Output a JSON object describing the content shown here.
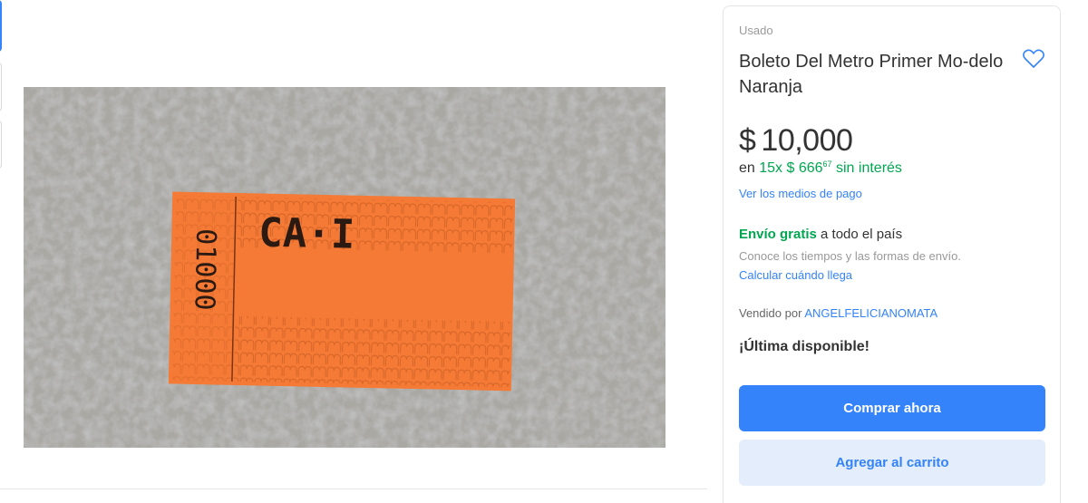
{
  "product": {
    "condition": "Usado",
    "title": "Boleto Del Metro Primer Mo-delo Naranja",
    "price": {
      "currency": "$",
      "amount": "10,000"
    },
    "installments": {
      "prefix": "en",
      "plan": "15x $ 666",
      "cents": "67",
      "suffix": "sin interés"
    },
    "payment_link": "Ver los medios de pago",
    "shipping": {
      "free": "Envío gratis",
      "rest": "a todo el país",
      "note": "Conoce los tiempos y las formas de envío.",
      "link": "Calcular cuándo llega"
    },
    "seller": {
      "label": "Vendido por",
      "name": "ANGELFELICIANOMATA"
    },
    "stock": "¡Última disponible!",
    "buy_label": "Comprar ahora",
    "cart_label": "Agregar al carrito"
  },
  "image": {
    "ticket_code": "CA·I",
    "ticket_serial": "01000"
  },
  "colors": {
    "accent": "#3483fa",
    "green": "#00a650",
    "ticket_orange": "#f47a35"
  },
  "icons": {
    "favorite": "heart-outline-icon"
  }
}
